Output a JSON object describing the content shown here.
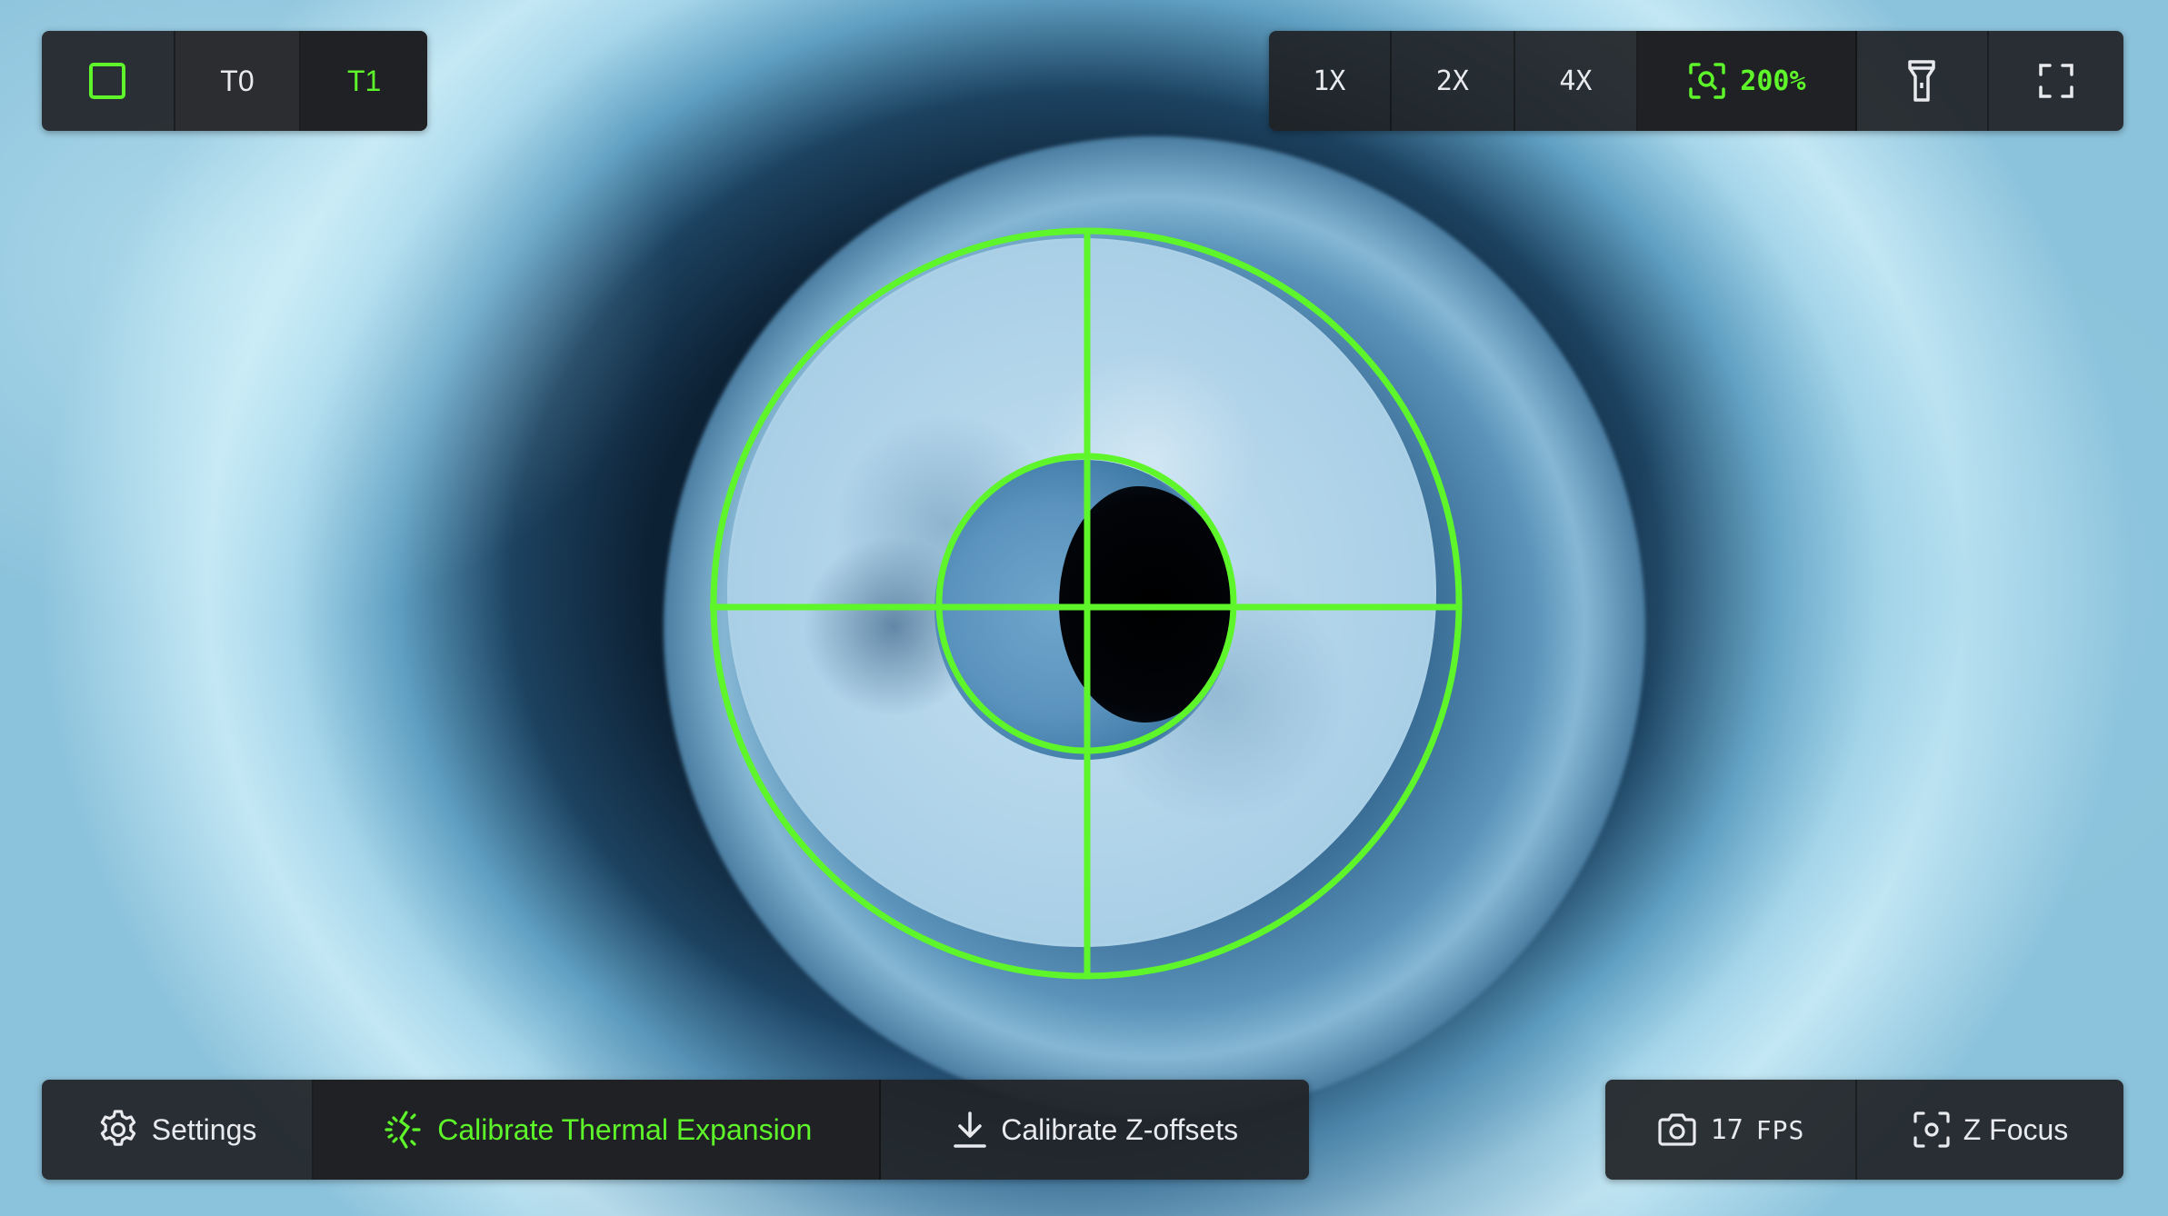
{
  "camera": {
    "tool_select": {
      "square_icon": "square-icon",
      "tools": [
        {
          "label": "T0",
          "active": false
        },
        {
          "label": "T1",
          "active": true
        }
      ]
    },
    "zoom": {
      "presets": [
        "1X",
        "2X",
        "4X"
      ],
      "current_label": "200%",
      "zoom_icon": "zoom-scan-icon"
    },
    "view_buttons": [
      "light-icon",
      "fullscreen-icon"
    ],
    "bottom_left": {
      "settings_label": "Settings",
      "calibrate_thermal_label": "Calibrate Thermal Expansion",
      "calibrate_z_label": "Calibrate Z-offsets"
    },
    "bottom_right": {
      "fps_value": "17",
      "fps_unit": "FPS",
      "z_focus_label": "Z Focus"
    },
    "colors": {
      "accent": "#5ef52a",
      "panel_bg": "#202225",
      "text": "#e8eaed"
    }
  }
}
